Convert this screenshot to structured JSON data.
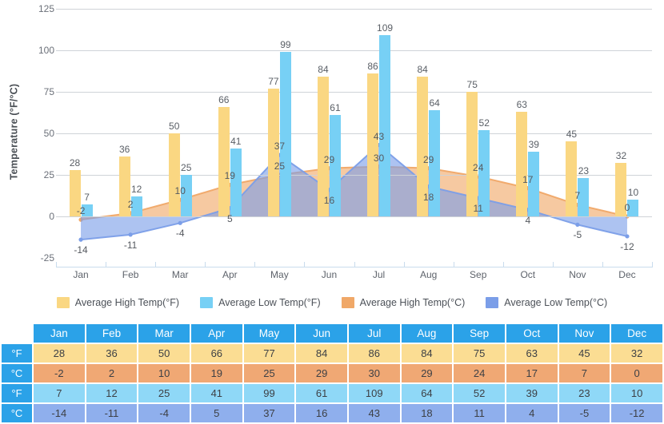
{
  "chart_data": {
    "type": "bar",
    "title": "",
    "xlabel": "",
    "ylabel": "Temperature (°F/°C)",
    "ylim": [
      -25,
      125
    ],
    "yticks": [
      125,
      100,
      75,
      50,
      25,
      0,
      -25
    ],
    "grid": true,
    "legend_position": "bottom",
    "categories": [
      "Jan",
      "Feb",
      "Mar",
      "Apr",
      "May",
      "Jun",
      "Jul",
      "Aug",
      "Sep",
      "Oct",
      "Nov",
      "Dec"
    ],
    "series": [
      {
        "name": "Average High Temp(°F)",
        "render": "bar",
        "color": "#fad782",
        "values": [
          28,
          36,
          50,
          66,
          77,
          84,
          86,
          84,
          75,
          63,
          45,
          32
        ]
      },
      {
        "name": "Average Low Temp(°F)",
        "render": "bar",
        "color": "#77d0f5",
        "values": [
          7,
          12,
          25,
          41,
          99,
          61,
          109,
          64,
          52,
          39,
          23,
          10
        ]
      },
      {
        "name": "Average High Temp(°C)",
        "render": "area",
        "color": "#f0a868",
        "values": [
          -2,
          2,
          10,
          19,
          25,
          29,
          30,
          29,
          24,
          17,
          7,
          0
        ]
      },
      {
        "name": "Average Low Temp(°C)",
        "render": "area",
        "color": "#7b9ee8",
        "values": [
          -14,
          -11,
          -4,
          5,
          37,
          16,
          43,
          18,
          11,
          4,
          -5,
          -12
        ]
      }
    ]
  },
  "legend": {
    "items": [
      {
        "label": "Average High Temp(°F)",
        "color": "#fad782"
      },
      {
        "label": "Average Low Temp(°F)",
        "color": "#77d0f5"
      },
      {
        "label": "Average High Temp(°C)",
        "color": "#f0a868"
      },
      {
        "label": "Average Low Temp(°C)",
        "color": "#7b9ee8"
      }
    ]
  },
  "table": {
    "corner_label": "",
    "columns": [
      "Jan",
      "Feb",
      "Mar",
      "Apr",
      "May",
      "Jun",
      "Jul",
      "Aug",
      "Sep",
      "Oct",
      "Nov",
      "Dec"
    ],
    "rows": [
      {
        "unit": "°F",
        "kind": "hi-f",
        "values": [
          "28",
          "36",
          "50",
          "66",
          "77",
          "84",
          "86",
          "84",
          "75",
          "63",
          "45",
          "32"
        ]
      },
      {
        "unit": "°C",
        "kind": "hi-c",
        "values": [
          "-2",
          "2",
          "10",
          "19",
          "25",
          "29",
          "30",
          "29",
          "24",
          "17",
          "7",
          "0"
        ]
      },
      {
        "unit": "°F",
        "kind": "lo-f",
        "values": [
          "7",
          "12",
          "25",
          "41",
          "99",
          "61",
          "109",
          "64",
          "52",
          "39",
          "23",
          "10"
        ]
      },
      {
        "unit": "°C",
        "kind": "lo-c",
        "values": [
          "-14",
          "-11",
          "-4",
          "5",
          "37",
          "16",
          "43",
          "18",
          "11",
          "4",
          "-5",
          "-12"
        ]
      }
    ]
  },
  "colors": {
    "high_f": "#fad782",
    "low_f": "#77d0f5",
    "high_c": "#f0a868",
    "low_c": "#7b9ee8",
    "table_header": "#2ba2e8",
    "gridline": "#cfd3d8"
  }
}
